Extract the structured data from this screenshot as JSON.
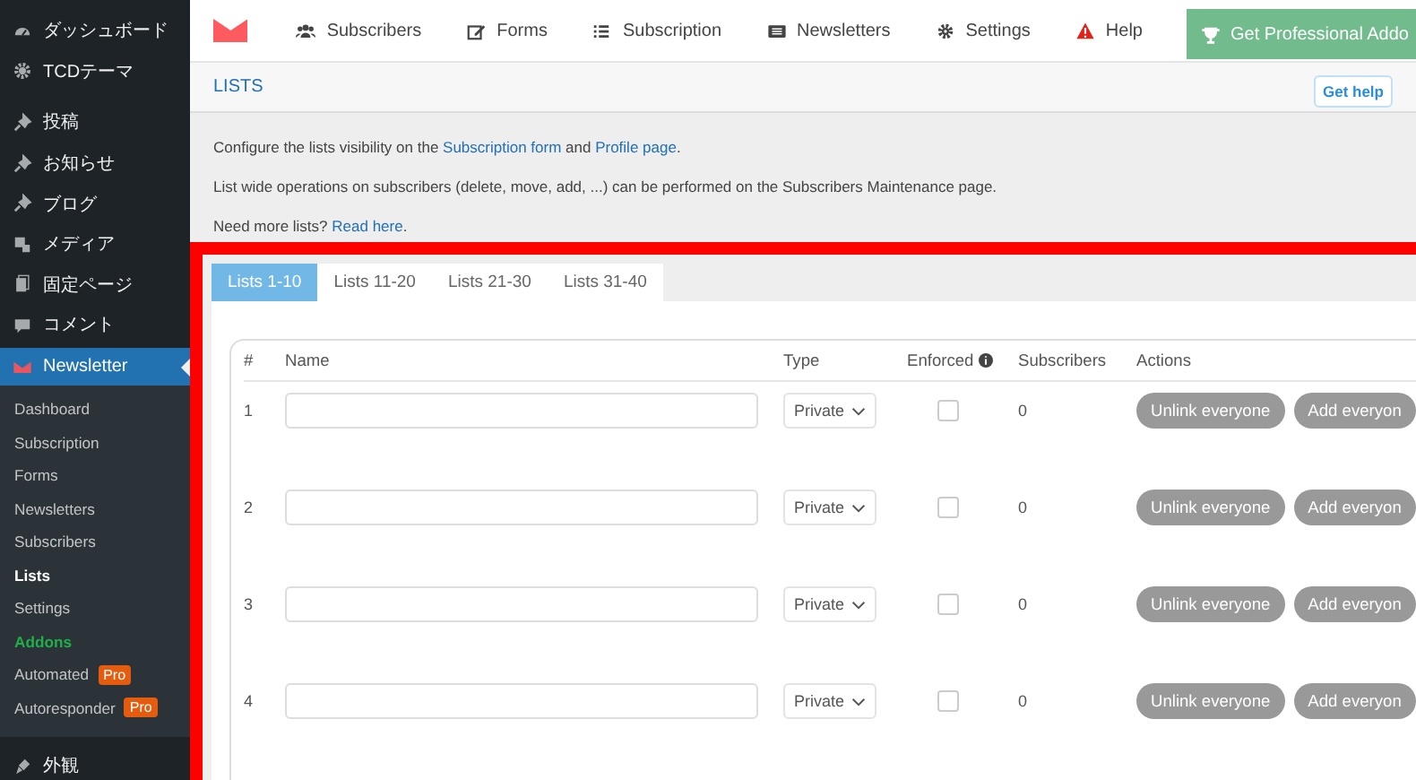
{
  "sidebar": {
    "items": [
      {
        "label": "ダッシュボード",
        "selected": false
      },
      {
        "label": "TCDテーマ",
        "selected": false
      },
      {
        "label": "投稿",
        "selected": false
      },
      {
        "label": "お知らせ",
        "selected": false
      },
      {
        "label": "ブログ",
        "selected": false
      },
      {
        "label": "メディア",
        "selected": false
      },
      {
        "label": "固定ページ",
        "selected": false
      },
      {
        "label": "コメント",
        "selected": false
      },
      {
        "label": "Newsletter",
        "selected": true,
        "children": [
          {
            "label": "Dashboard",
            "selected": false,
            "kind": "plain"
          },
          {
            "label": "Subscription",
            "selected": false,
            "kind": "plain"
          },
          {
            "label": "Forms",
            "selected": false,
            "kind": "plain"
          },
          {
            "label": "Newsletters",
            "selected": false,
            "kind": "plain"
          },
          {
            "label": "Subscribers",
            "selected": false,
            "kind": "plain"
          },
          {
            "label": "Lists",
            "selected": true,
            "kind": "plain"
          },
          {
            "label": "Settings",
            "selected": false,
            "kind": "plain"
          },
          {
            "label": "Addons",
            "selected": false,
            "kind": "addon"
          },
          {
            "label": "Automated",
            "selected": false,
            "kind": "plain",
            "badge": "Pro"
          },
          {
            "label": "Autoresponder",
            "selected": false,
            "kind": "plain",
            "badge": "Pro"
          }
        ]
      },
      {
        "label": "外観",
        "selected": false
      }
    ]
  },
  "nav": {
    "items": [
      {
        "label": "Subscribers"
      },
      {
        "label": "Forms"
      },
      {
        "label": "Subscription"
      },
      {
        "label": "Newsletters"
      },
      {
        "label": "Settings"
      },
      {
        "label": "Help"
      }
    ],
    "cta": "Get Professional Addo"
  },
  "header": {
    "title": "LISTS",
    "help_button": "Get help"
  },
  "intro": [
    {
      "parts": [
        {
          "text": "Configure the lists visibility on the ",
          "link": false
        },
        {
          "text": "Subscription form",
          "link": true
        },
        {
          "text": " and ",
          "link": false
        },
        {
          "text": "Profile page",
          "link": true
        },
        {
          "text": ".",
          "link": false
        }
      ]
    },
    {
      "parts": [
        {
          "text": "List wide operations on subscribers (delete, move, add, ...) can be performed on the Subscribers Maintenance page.",
          "link": false
        }
      ]
    },
    {
      "parts": [
        {
          "text": "Need more lists? ",
          "link": false
        },
        {
          "text": "Read here",
          "link": true
        },
        {
          "text": ".",
          "link": false
        }
      ]
    }
  ],
  "tabs": [
    {
      "label": "Lists 1-10",
      "selected": true
    },
    {
      "label": "Lists 11-20",
      "selected": false
    },
    {
      "label": "Lists 21-30",
      "selected": false
    },
    {
      "label": "Lists 31-40",
      "selected": false
    }
  ],
  "table": {
    "columns": [
      "#",
      "Name",
      "Type",
      "Enforced",
      "Subscribers",
      "Actions"
    ],
    "rows": [
      {
        "number": "1",
        "type": "Private",
        "enforced": false,
        "subscribers": "0",
        "actions": [
          "Unlink everyone",
          "Add everyon"
        ]
      },
      {
        "number": "2",
        "type": "Private",
        "enforced": false,
        "subscribers": "0",
        "actions": [
          "Unlink everyone",
          "Add everyon"
        ]
      },
      {
        "number": "3",
        "type": "Private",
        "enforced": false,
        "subscribers": "0",
        "actions": [
          "Unlink everyone",
          "Add everyon"
        ]
      },
      {
        "number": "4",
        "type": "Private",
        "enforced": false,
        "subscribers": "0",
        "actions": [
          "Unlink everyone",
          "Add everyon"
        ]
      }
    ]
  }
}
